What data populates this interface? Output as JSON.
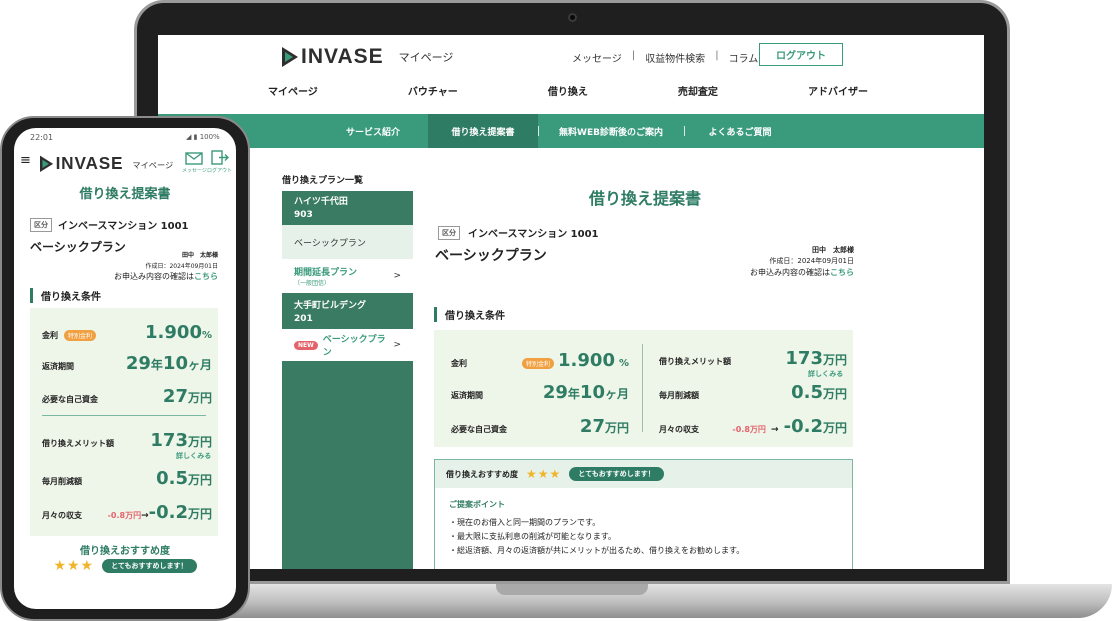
{
  "laptop": {
    "brand": "INVASE",
    "brand_sub": "マイページ",
    "top_links": [
      "メッセージ",
      "収益物件検索",
      "コラム"
    ],
    "logout_label": "ログアウト",
    "main_nav": [
      "マイページ",
      "バウチャー",
      "借り換え",
      "売却査定",
      "アドバイザー"
    ],
    "sub_nav": [
      "サービス紹介",
      "借り換え提案書",
      "無料WEB診断後のご案内",
      "よくあるご質問"
    ],
    "plan_list_title": "借り換えプラン一覧",
    "plans": {
      "prop1_name": "ハイツ千代田",
      "prop1_room": "903",
      "prop1_plan": "ベーシックプラン",
      "prop1_plan2": "期間延長プラン",
      "prop1_plan2_sub": "（一般団信）",
      "prop2_name": "大手町ビルデング",
      "prop2_room": "201",
      "new_badge": "NEW",
      "prop2_plan": "ベーシックプラン",
      "chevron": ">"
    },
    "doc_title": "借り換え提案書",
    "kubun": "区分",
    "property_name": "インベースマンション 1001",
    "plan_name": "ベーシックプラン",
    "customer": "田中　太郎様",
    "created": "作成日：2024年09月01日",
    "confirm_text": "お申込み内容の確認は",
    "confirm_link": "こちら",
    "cond_heading": "借り換え条件",
    "conditions": {
      "rate_label": "金利",
      "rate_badge": "特別金利",
      "rate_value": "1.900",
      "rate_unit": "%",
      "period_label": "返済期間",
      "period_years": "29",
      "period_years_unit": "年",
      "period_months": "10",
      "period_months_unit": "ヶ月",
      "funds_label": "必要な自己資金",
      "funds_value": "27",
      "funds_unit": "万円",
      "merit_label": "借り換えメリット額",
      "merit_value": "173",
      "merit_unit": "万円",
      "merit_detail": "詳しくみる",
      "monthly_label": "毎月削減額",
      "monthly_value": "0.5",
      "monthly_unit": "万円",
      "balance_label": "月々の収支",
      "balance_before": "-0.8万円",
      "arrow": "→",
      "balance_after": "-0.2",
      "balance_unit": "万円"
    },
    "recommend": {
      "label": "借り換えおすすめ度",
      "stars": "★★★",
      "badge": "とてもおすすめします！",
      "points_title": "ご提案ポイント",
      "points": [
        "・現在のお借入と同一期間のプランです。",
        "・最大限に支払利息の削減が可能となります。",
        "・総返済額、月々の返済額が共にメリットが出るため、借り換えをお勧めします。"
      ]
    }
  },
  "phone": {
    "time": "22:01",
    "battery": "100%",
    "menu_icon": "≡",
    "brand": "INVASE",
    "brand_sub": "マイページ",
    "message_label": "メッセージ",
    "logout_label": "ログアウト",
    "title": "借り換え提案書",
    "kubun": "区分",
    "property_name": "インベースマンション 1001",
    "plan_name": "ベーシックプラン",
    "customer": "田中　太郎様",
    "created": "作成日：2024年09月01日",
    "confirm_text": "お申込み内容の確認は",
    "confirm_link": "こちら",
    "cond_heading": "借り換え条件",
    "rec_label": "借り換えおすすめ度",
    "stars": "★★★",
    "badge": "とてもおすすめします！"
  },
  "colors": {
    "primary": "#3a9a7c",
    "primary_dark": "#2f7c64",
    "sidebar": "#3a7b63",
    "negative": "#e4636b",
    "badge_orange": "#f0a040",
    "panel": "#eef5e9"
  }
}
